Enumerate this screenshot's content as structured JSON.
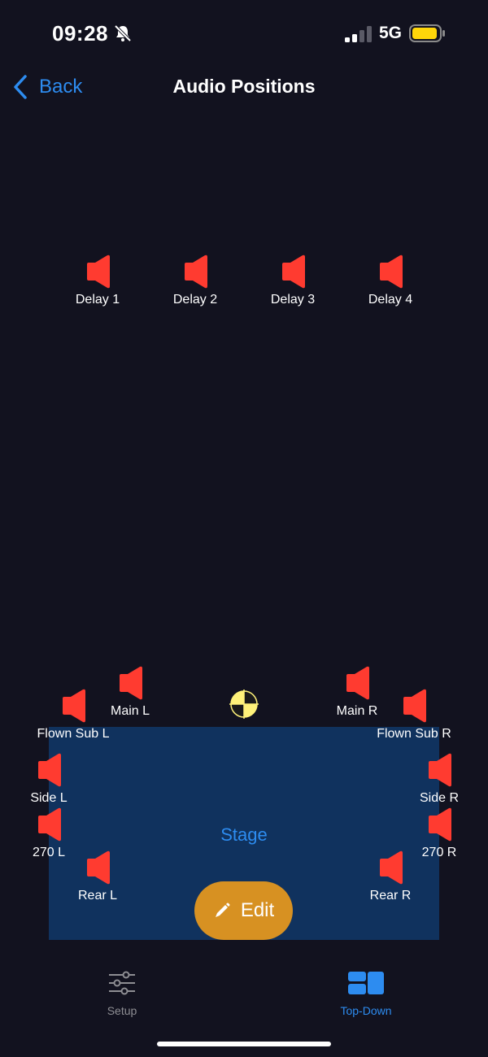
{
  "status_bar": {
    "time": "09:28",
    "network": "5G",
    "battery_color": "#ffd60a"
  },
  "nav": {
    "back_label": "Back",
    "title": "Audio Positions"
  },
  "stage": {
    "label": "Stage",
    "fill_color": "#10325e"
  },
  "speaker_color": "#ff3b30",
  "speakers": {
    "delay_1": "Delay 1",
    "delay_2": "Delay 2",
    "delay_3": "Delay 3",
    "delay_4": "Delay 4",
    "main_l": "Main L",
    "main_r": "Main R",
    "flown_sub_l": "Flown Sub L",
    "flown_sub_r": "Flown Sub R",
    "side_l": "Side L",
    "side_r": "Side R",
    "r270_l": "270 L",
    "r270_r": "270 R",
    "rear_l": "Rear L",
    "rear_r": "Rear R"
  },
  "edit_button": {
    "label": "Edit",
    "color": "#d79122"
  },
  "tab_bar": {
    "setup": {
      "label": "Setup",
      "icon": "sliders-icon",
      "active": false
    },
    "top_down": {
      "label": "Top-Down",
      "icon": "top-down-layout-icon",
      "active": true
    }
  },
  "colors": {
    "background": "#12121f",
    "accent": "#2d8cf0",
    "inactive": "#8e8e93"
  }
}
